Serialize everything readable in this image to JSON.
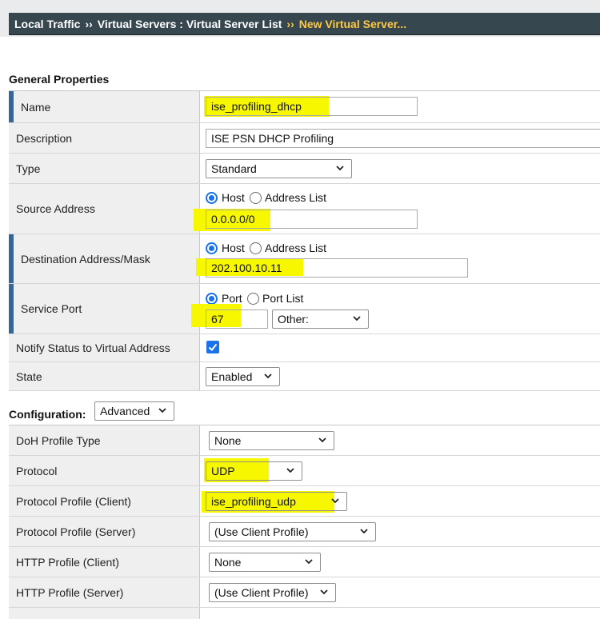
{
  "breadcrumb": {
    "items": [
      "Local Traffic",
      "Virtual Servers : Virtual Server List"
    ],
    "separator": "››",
    "current": "New Virtual Server..."
  },
  "general": {
    "title": "General Properties",
    "name": {
      "label": "Name",
      "value": "ise_profiling_dhcp"
    },
    "description": {
      "label": "Description",
      "value": "ISE PSN DHCP Profiling"
    },
    "type": {
      "label": "Type",
      "value": "Standard"
    },
    "source": {
      "label": "Source Address",
      "radio_host": "Host",
      "radio_list": "Address List",
      "value": "0.0.0.0/0"
    },
    "destination": {
      "label": "Destination Address/Mask",
      "radio_host": "Host",
      "radio_list": "Address List",
      "value": "202.100.10.11"
    },
    "service_port": {
      "label": "Service Port",
      "radio_port": "Port",
      "radio_list": "Port List",
      "value": "67",
      "select_value": "Other:"
    },
    "notify": {
      "label": "Notify Status to Virtual Address",
      "checked": true
    },
    "state": {
      "label": "State",
      "value": "Enabled"
    }
  },
  "configuration": {
    "title": "Configuration:",
    "mode": "Advanced",
    "doh": {
      "label": "DoH Profile Type",
      "value": "None"
    },
    "protocol": {
      "label": "Protocol",
      "value": "UDP"
    },
    "pp_client": {
      "label": "Protocol Profile (Client)",
      "value": "ise_profiling_udp"
    },
    "pp_server": {
      "label": "Protocol Profile (Server)",
      "value": "(Use Client Profile)"
    },
    "http_client": {
      "label": "HTTP Profile (Client)",
      "value": "None"
    },
    "http_server": {
      "label": "HTTP Profile (Server)",
      "value": "(Use Client Profile)"
    }
  },
  "colors": {
    "highlight": "#f7f700",
    "required_bar": "#376596",
    "header_bg": "#37474f",
    "breadcrumb_current": "#ffc940",
    "accent": "#1a73e8"
  }
}
